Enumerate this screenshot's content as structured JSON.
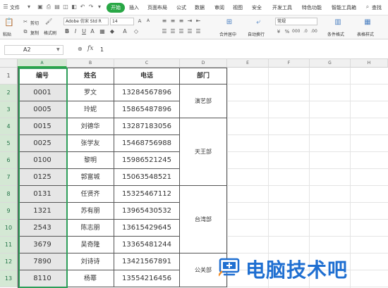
{
  "menubar": {
    "file_label": "文件",
    "tabs": [
      {
        "label": "开始",
        "active": true
      },
      {
        "label": "插入"
      },
      {
        "label": "页面布局"
      },
      {
        "label": "公式"
      },
      {
        "label": "数据"
      },
      {
        "label": "审阅"
      },
      {
        "label": "视图"
      },
      {
        "label": "安全"
      },
      {
        "label": "开发工具"
      },
      {
        "label": "特色功能"
      },
      {
        "label": "智能工具箱"
      }
    ],
    "search_label": "查找",
    "accent_color": "#28a745"
  },
  "ribbon": {
    "paste_label": "粘贴",
    "cut_label": "剪切",
    "copy_label": "复制",
    "format_painter_label": "格式刷",
    "font_name": "Adobe 仿宋 Std R",
    "font_size": "14",
    "merge_label": "合并居中",
    "wrap_label": "自动换行",
    "number_format": "常规",
    "conditional_format_label": "条件格式",
    "table_style_label": "表格样式"
  },
  "formula_bar": {
    "cell_ref": "A2",
    "fx_label": "fx",
    "value": "1"
  },
  "sheet": {
    "columns": [
      "A",
      "B",
      "C",
      "D",
      "E",
      "F",
      "G",
      "H"
    ],
    "row_numbers": [
      "1",
      "2",
      "3",
      "4",
      "5",
      "6",
      "7",
      "8",
      "9",
      "10",
      "11",
      "12",
      "13"
    ],
    "headers": {
      "id": "编号",
      "name": "姓名",
      "phone": "电话",
      "dept": "部门"
    },
    "rows": [
      {
        "id": "0001",
        "name": "罗文",
        "phone": "13284567896"
      },
      {
        "id": "0005",
        "name": "玲妮",
        "phone": "15865487896"
      },
      {
        "id": "0015",
        "name": "刘德华",
        "phone": "13287183056"
      },
      {
        "id": "0025",
        "name": "张学友",
        "phone": "15468756988"
      },
      {
        "id": "0100",
        "name": "黎明",
        "phone": "15986521245"
      },
      {
        "id": "0125",
        "name": "郭富城",
        "phone": "15063548521"
      },
      {
        "id": "0131",
        "name": "任贤齐",
        "phone": "15325467112"
      },
      {
        "id": "1321",
        "name": "苏有朋",
        "phone": "13965430532"
      },
      {
        "id": "2543",
        "name": "陈志朋",
        "phone": "13615429645"
      },
      {
        "id": "3679",
        "name": "吴奇隆",
        "phone": "13365481244"
      },
      {
        "id": "7890",
        "name": "刘诗诗",
        "phone": "13421567891"
      },
      {
        "id": "8110",
        "name": "杨幂",
        "phone": "13554216456"
      }
    ],
    "departments": [
      "演艺部",
      "天王部",
      "台湾部",
      "公关部"
    ]
  },
  "watermark": {
    "text": "电脑技术吧",
    "color": "#1f6fd1"
  }
}
